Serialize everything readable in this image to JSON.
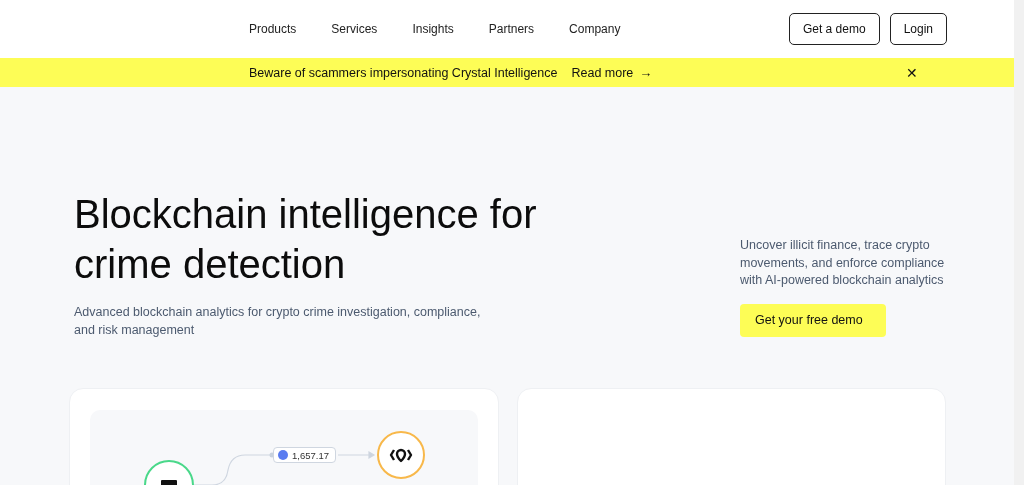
{
  "nav": {
    "links": [
      "Products",
      "Services",
      "Insights",
      "Partners",
      "Company"
    ],
    "buttons": [
      "Get a demo",
      "Login"
    ]
  },
  "banner": {
    "message": "Beware of scammers impersonating Crystal Intelligence",
    "link": "Read more",
    "arrow": "→",
    "close": "✕"
  },
  "hero": {
    "title": "Blockchain intelligence for crime detection",
    "subtitle": "Advanced blockchain analytics for crypto crime investigation, compliance, and risk management",
    "description": "Uncover illicit finance, trace crypto movements, and enforce compliance with AI-powered blockchain analytics",
    "cta": "Get your free demo"
  },
  "diagram": {
    "amount": "1,657.17"
  }
}
